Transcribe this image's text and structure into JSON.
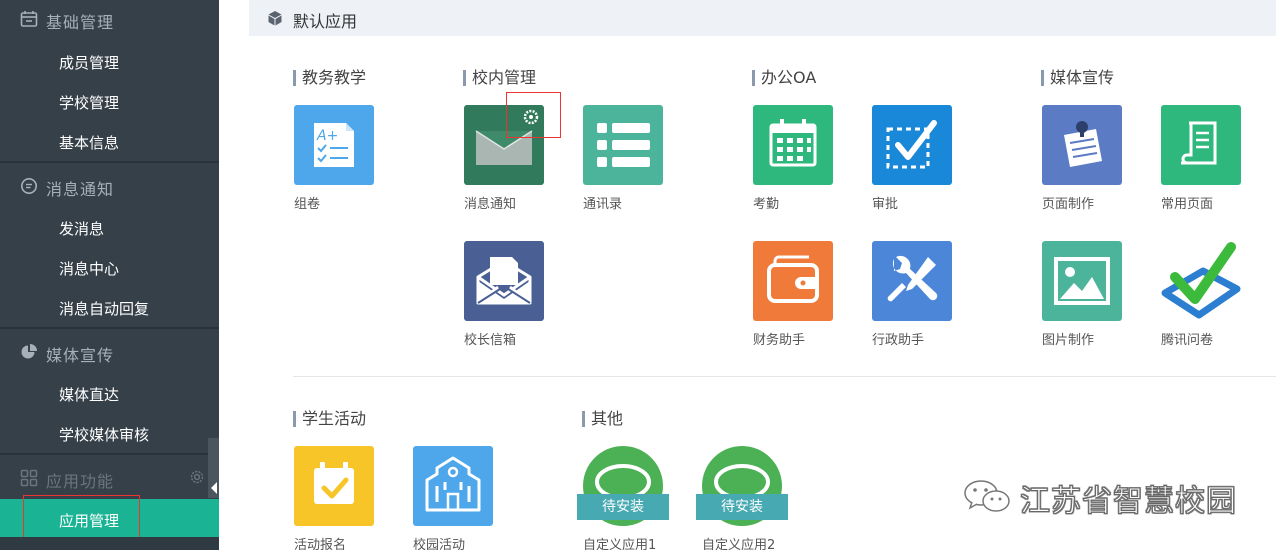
{
  "sidebar": {
    "sections": [
      {
        "label": "基础管理",
        "icon": "calendar-icon",
        "items": [
          "成员管理",
          "学校管理",
          "基本信息"
        ]
      },
      {
        "label": "消息通知",
        "icon": "chat-bubble-icon",
        "items": [
          "发消息",
          "消息中心",
          "消息自动回复"
        ]
      },
      {
        "label": "媒体宣传",
        "icon": "pie-chart-icon",
        "items": [
          "媒体直达",
          "学校媒体审核"
        ]
      },
      {
        "label": "应用功能",
        "icon": "apps-icon",
        "items": [
          "应用管理"
        ]
      }
    ],
    "active_item": "应用管理",
    "colors": {
      "bg": "#354049",
      "active": "#1ab394"
    }
  },
  "main": {
    "header": {
      "title": "默认应用",
      "icon": "cube-icon"
    },
    "categories": [
      {
        "label": "教务教学",
        "apps": [
          "组卷"
        ]
      },
      {
        "label": "校内管理",
        "apps": [
          "消息通知",
          "通讯录",
          "校长信箱"
        ]
      },
      {
        "label": "办公OA",
        "apps": [
          "考勤",
          "审批",
          "财务助手",
          "行政助手"
        ]
      },
      {
        "label": "媒体宣传",
        "apps": [
          "页面制作",
          "常用页面",
          "图片制作",
          "腾讯问卷"
        ]
      },
      {
        "label": "学生活动",
        "apps": [
          "活动报名",
          "校园活动"
        ]
      },
      {
        "label": "其他",
        "apps": [
          "自定义应用1",
          "自定义应用2"
        ]
      }
    ],
    "install_badge": "待安装"
  },
  "watermark": {
    "text": "江苏省智慧校园",
    "icon": "wechat-icon"
  }
}
